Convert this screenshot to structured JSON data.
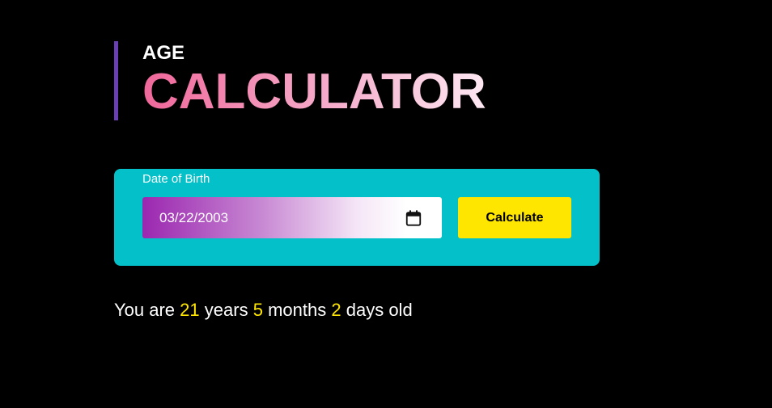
{
  "header": {
    "small_title": "AGE",
    "big_title": "CALCULATOR"
  },
  "form": {
    "dob_label": "Date of Birth",
    "date_value": "03/22/2003",
    "calendar_icon": "calendar-icon",
    "button_label": "Calculate"
  },
  "result": {
    "prefix": "You are",
    "years": "21",
    "years_word": "years",
    "months": "5",
    "months_word": "months",
    "days": "2",
    "days_word": "days old"
  },
  "colors": {
    "background": "#000000",
    "accent_bar": "#6a3fb5",
    "card": "#04c0c8",
    "button": "#ffe600",
    "highlight_number": "#ffe600",
    "title_gradient_start": "#f0679a",
    "title_gradient_end": "#fde8f2",
    "input_gradient_start": "#9b27b0"
  }
}
